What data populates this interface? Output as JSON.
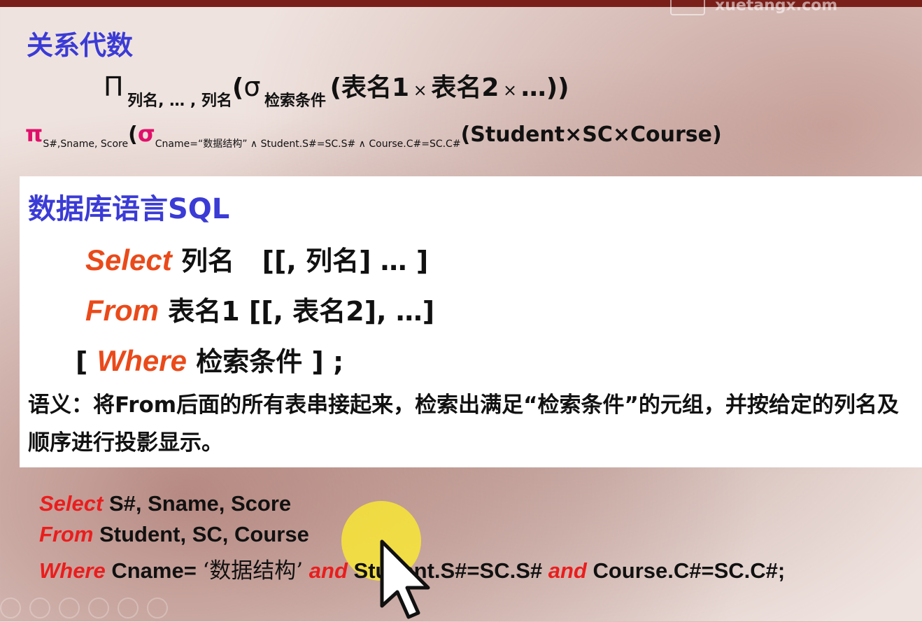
{
  "watermark": {
    "text": "xuetangx.com"
  },
  "algebra": {
    "title": "关系代数",
    "general": {
      "pi": "Π",
      "proj_sub": "列名, … , 列名",
      "open_paren": "(",
      "sigma": "σ",
      "cond_sub": "检索条件",
      "tables": "(表名1",
      "times1": "×",
      "t2": "表名2",
      "times2": "×",
      "tail": "…))"
    },
    "example": {
      "pi": "π",
      "proj_sub": "S#,Sname, Score",
      "open_paren": "(",
      "sigma": "σ",
      "cond_sub": "Cname=“数据结构” ∧ Student.S#=SC.S# ∧ Course.C#=SC.C#",
      "tables": "(Student×SC×Course)"
    }
  },
  "sql": {
    "title": "数据库语言SQL",
    "select_kw": "Select",
    "select_rest": "列名   [[, 列名] … ]",
    "from_kw": "From",
    "from_rest": "表名1 [[, 表名2], …]",
    "where_open": "[",
    "where_kw": "Where",
    "where_rest": "检索条件 ] ;",
    "semantics": "语义：将From后面的所有表串接起来，检索出满足“检索条件”的元组，并按给定的列名及顺序进行投影显示。"
  },
  "example_query": {
    "line1_kw": "Select",
    "line1_rest": " S#, Sname, Score",
    "line2_kw": "From",
    "line2_rest": " Student, SC, Course",
    "line3_kw": "Where",
    "line3_a": " Cname= ",
    "line3_cn": "‘数据结构’",
    "line3_and1": " and ",
    "line3_b": "Student.S#=SC.S# ",
    "line3_and2": "and",
    "line3_c": " Course.C#=SC.C#;"
  }
}
